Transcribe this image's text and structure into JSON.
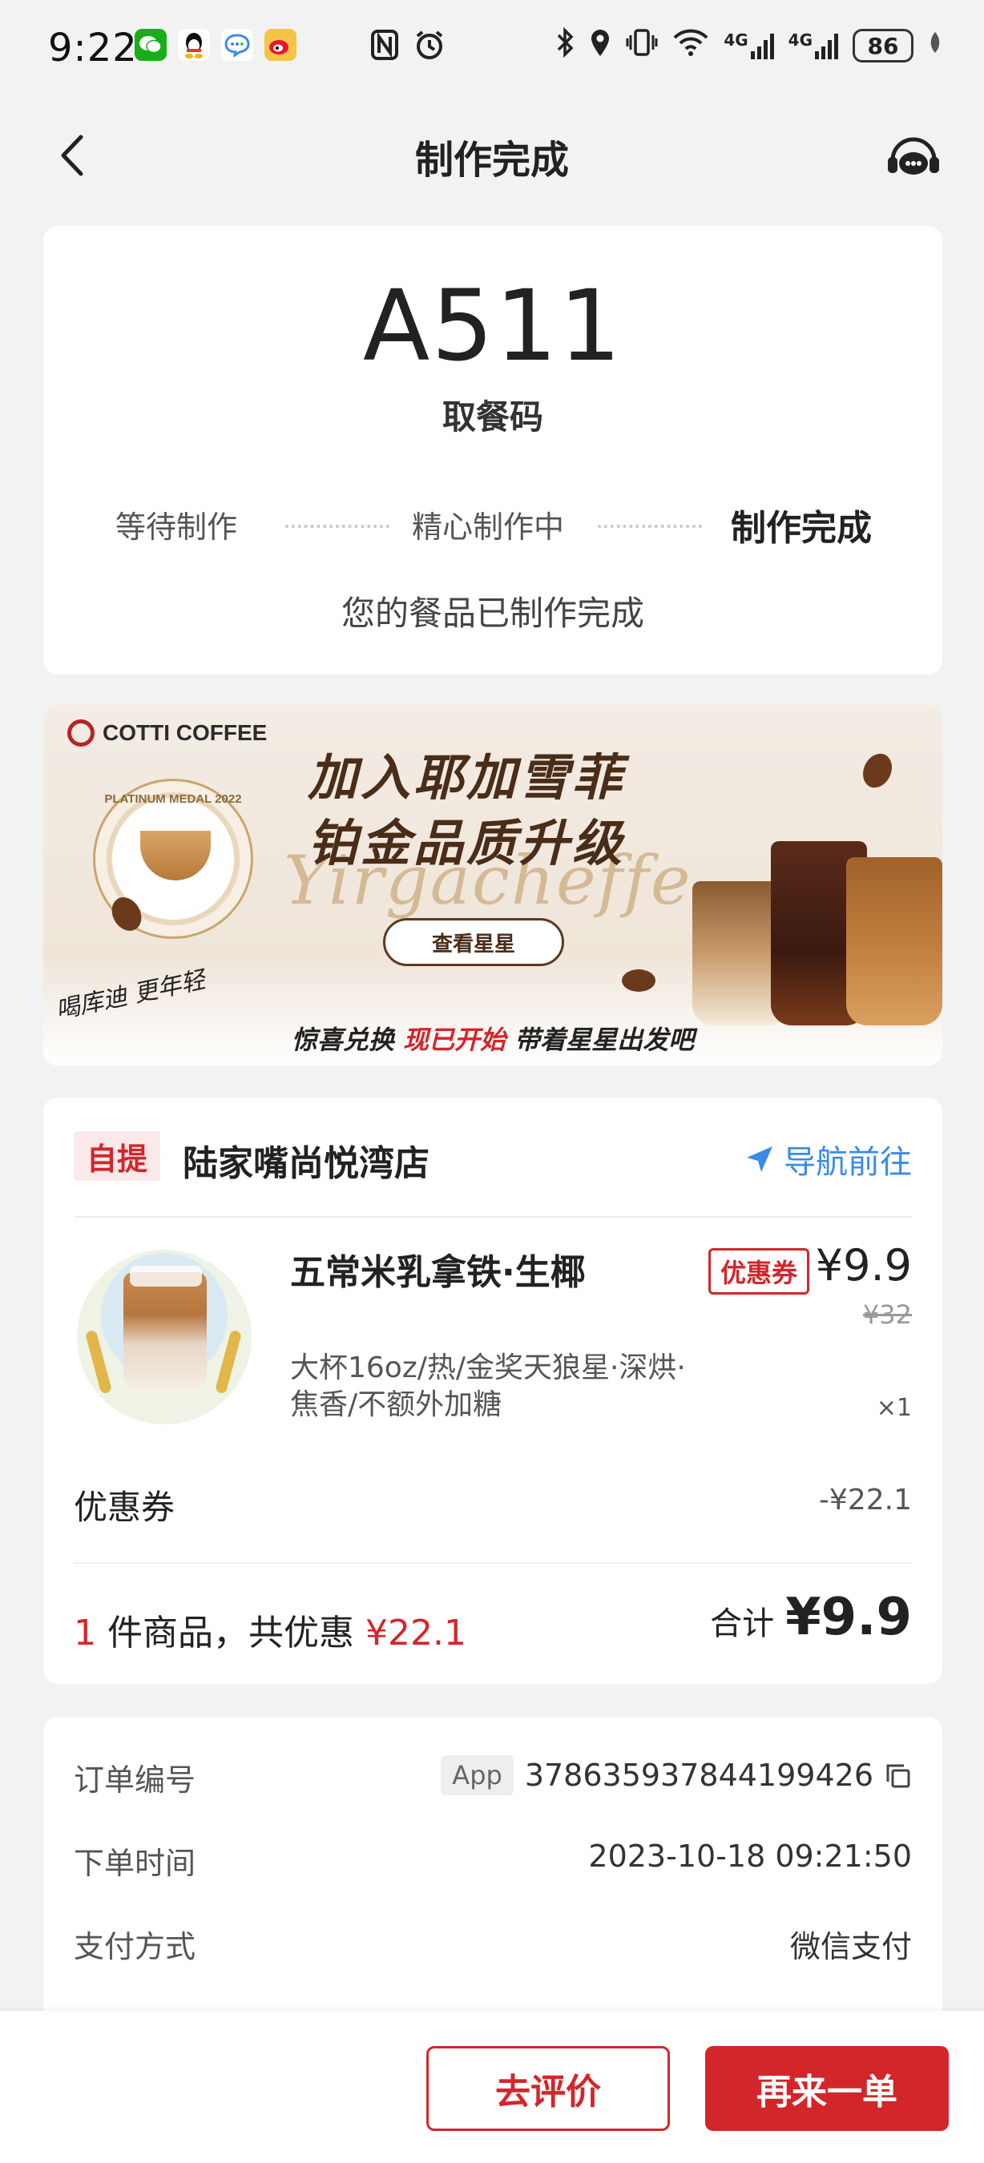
{
  "status_bar": {
    "time": "9:22",
    "battery": "86",
    "network_1": "4G",
    "network_2": "4G",
    "apps": [
      "wechat-icon",
      "qq-icon",
      "messages-icon",
      "weibo-icon"
    ]
  },
  "header": {
    "title": "制作完成"
  },
  "pickup": {
    "code": "A511",
    "code_label": "取餐码",
    "steps": [
      "等待制作",
      "精心制作中",
      "制作完成"
    ],
    "message": "您的餐品已制作完成"
  },
  "banner": {
    "brand": "COTTI COFFEE",
    "medal_text": "PLATINUM MEDAL 2022",
    "headline_1": "加入耶加雪菲",
    "headline_2": "铂金品质升级",
    "script_text": "Yirgacheffe",
    "button_label": "查看星星",
    "slogan": "喝库迪 更年轻",
    "footer_prefix": "惊喜兑换",
    "footer_highlight": "现已开始",
    "footer_suffix": "带着星星出发吧"
  },
  "order": {
    "pickup_tag": "自提",
    "store_name": "陆家嘴尚悦湾店",
    "navigate_label": "导航前往",
    "item": {
      "name": "五常米乳拿铁·生椰",
      "coupon_badge": "优惠券",
      "price": "¥9.9",
      "original_price": "¥32",
      "spec": "大杯16oz/热/金奖天狼星·深烘·焦香/不额外加糖",
      "quantity": "×1"
    },
    "coupon_label": "优惠券",
    "coupon_value": "-¥22.1",
    "summary_count": "1",
    "summary_text": "件商品，共优惠",
    "summary_discount": "¥22.1",
    "total_label": "合计",
    "total_value": "¥9.9"
  },
  "info": {
    "order_no_label": "订单编号",
    "order_no_tag": "App",
    "order_no": "378635937844199426",
    "order_time_label": "下单时间",
    "order_time": "2023-10-18 09:21:50",
    "payment_label": "支付方式",
    "payment": "微信支付"
  },
  "bottom": {
    "review_label": "去评价",
    "reorder_label": "再来一单"
  },
  "colors": {
    "accent": "#d3262b",
    "link": "#3a8be8",
    "background": "#f2f2f2"
  }
}
